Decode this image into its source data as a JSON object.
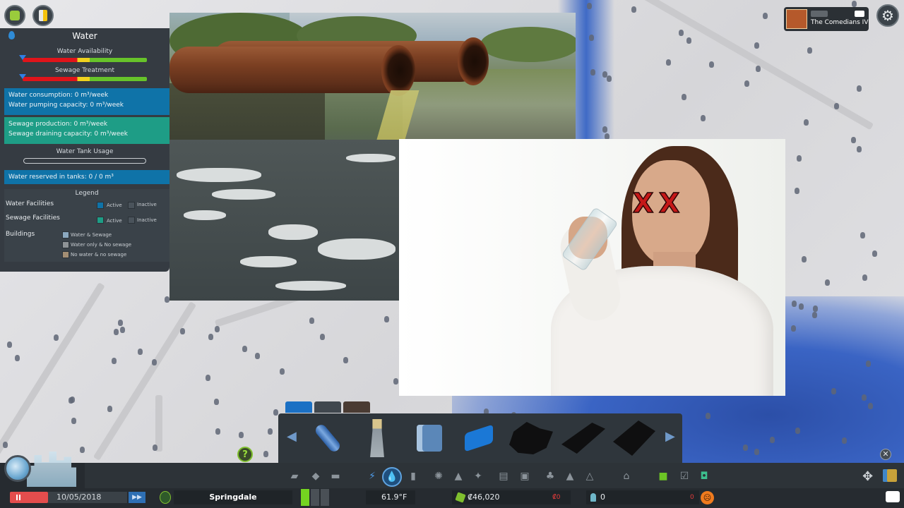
{
  "water_panel": {
    "title": "Water",
    "water_availability_label": "Water Availability",
    "sewage_treatment_label": "Sewage Treatment",
    "water_consumption": "Water consumption: 0 m³/week",
    "water_pumping_capacity": "Water pumping capacity: 0 m³/week",
    "sewage_production": "Sewage production: 0 m³/week",
    "sewage_draining_capacity": "Sewage draining capacity: 0 m³/week",
    "water_tank_usage_label": "Water Tank Usage",
    "water_reserved": "Water reserved in tanks: 0 / 0 m³",
    "legend": {
      "title": "Legend",
      "water_facilities": "Water Facilities",
      "sewage_facilities": "Sewage Facilities",
      "buildings": "Buildings",
      "active": "Active",
      "inactive": "Inactive",
      "water_and_sewage": "Water & Sewage",
      "water_only": "Water only & No sewage",
      "no_water": "No water & no sewage",
      "colors": {
        "water_active": "#0f73a8",
        "sewage_active": "#1e9d86",
        "inactive": "#4a535b",
        "water_and_sewage": "#8ba8bf",
        "water_only": "#8e9396",
        "no_water": "#a38e74"
      }
    }
  },
  "overlay": {
    "x_mark_left": "X",
    "x_mark_right": "X"
  },
  "radio": {
    "station": "The Comedians IV"
  },
  "tool_tray": {
    "tools": [
      "water-pipe-icon",
      "water-tower-icon",
      "water-pumping-station-icon",
      "water-drain-pipe-icon",
      "water-treatment-plant-icon",
      "large-water-facility-icon",
      "water-pumping-service-icon"
    ]
  },
  "bottom_bar": {
    "date": "10/05/2018",
    "speed": "▶▶",
    "city_name": "Springdale",
    "temperature": "61.9°F",
    "money": "₡46,020",
    "income": "₡0",
    "population": "0",
    "population_change": "0",
    "help": "?",
    "close": "✕",
    "settings": "⚙"
  }
}
